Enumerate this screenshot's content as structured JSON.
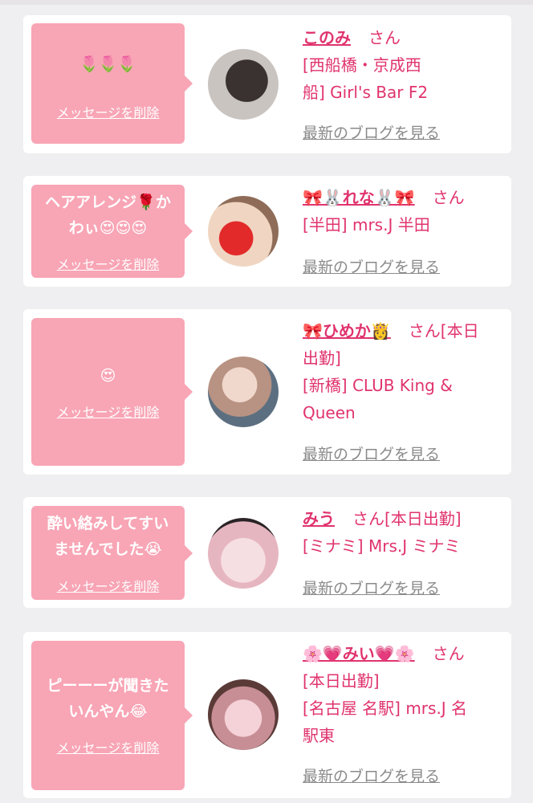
{
  "colors": {
    "accent": "#e0336e",
    "bubble": "#f8a5b5",
    "card": "#ffffff",
    "background": "#efeef0"
  },
  "cards": [
    {
      "message": "🌷🌷🌷",
      "delete_label": "メッセージを削除",
      "name": "このみ",
      "honorific": "さん",
      "shop": "[西船橋・京成西\n船] Girl's Bar F2",
      "blog_label": "最新のブログを見る"
    },
    {
      "message": "ヘアアレンジ🌹か\nわぃ😍😍😍",
      "delete_label": "メッセージを削除",
      "name": "🎀🐰れな🐰🎀",
      "honorific": "さん",
      "shop": "[半田] mrs.J 半田",
      "blog_label": "最新のブログを見る"
    },
    {
      "message": "😍",
      "delete_label": "メッセージを削除",
      "name": "🎀ひめか👸",
      "honorific": "さん[本日\n出勤]",
      "shop": "[新橋] CLUB King &\nQueen",
      "blog_label": "最新のブログを見る"
    },
    {
      "message": "酔い絡みしてすい\nませんでした😭",
      "delete_label": "メッセージを削除",
      "name": "みう",
      "honorific": "さん[本日出勤]",
      "shop": "[ミナミ] Mrs.J ミナミ",
      "blog_label": "最新のブログを見る"
    },
    {
      "message": "ピーーーが聞きた\nいんやん😂",
      "delete_label": "メッセージを削除",
      "name": "🌸💗みい💗🌸",
      "honorific": "さん\n[本日出勤]",
      "shop": "[名古屋 名駅] mrs.J 名\n駅東",
      "blog_label": "最新のブログを見る"
    }
  ]
}
